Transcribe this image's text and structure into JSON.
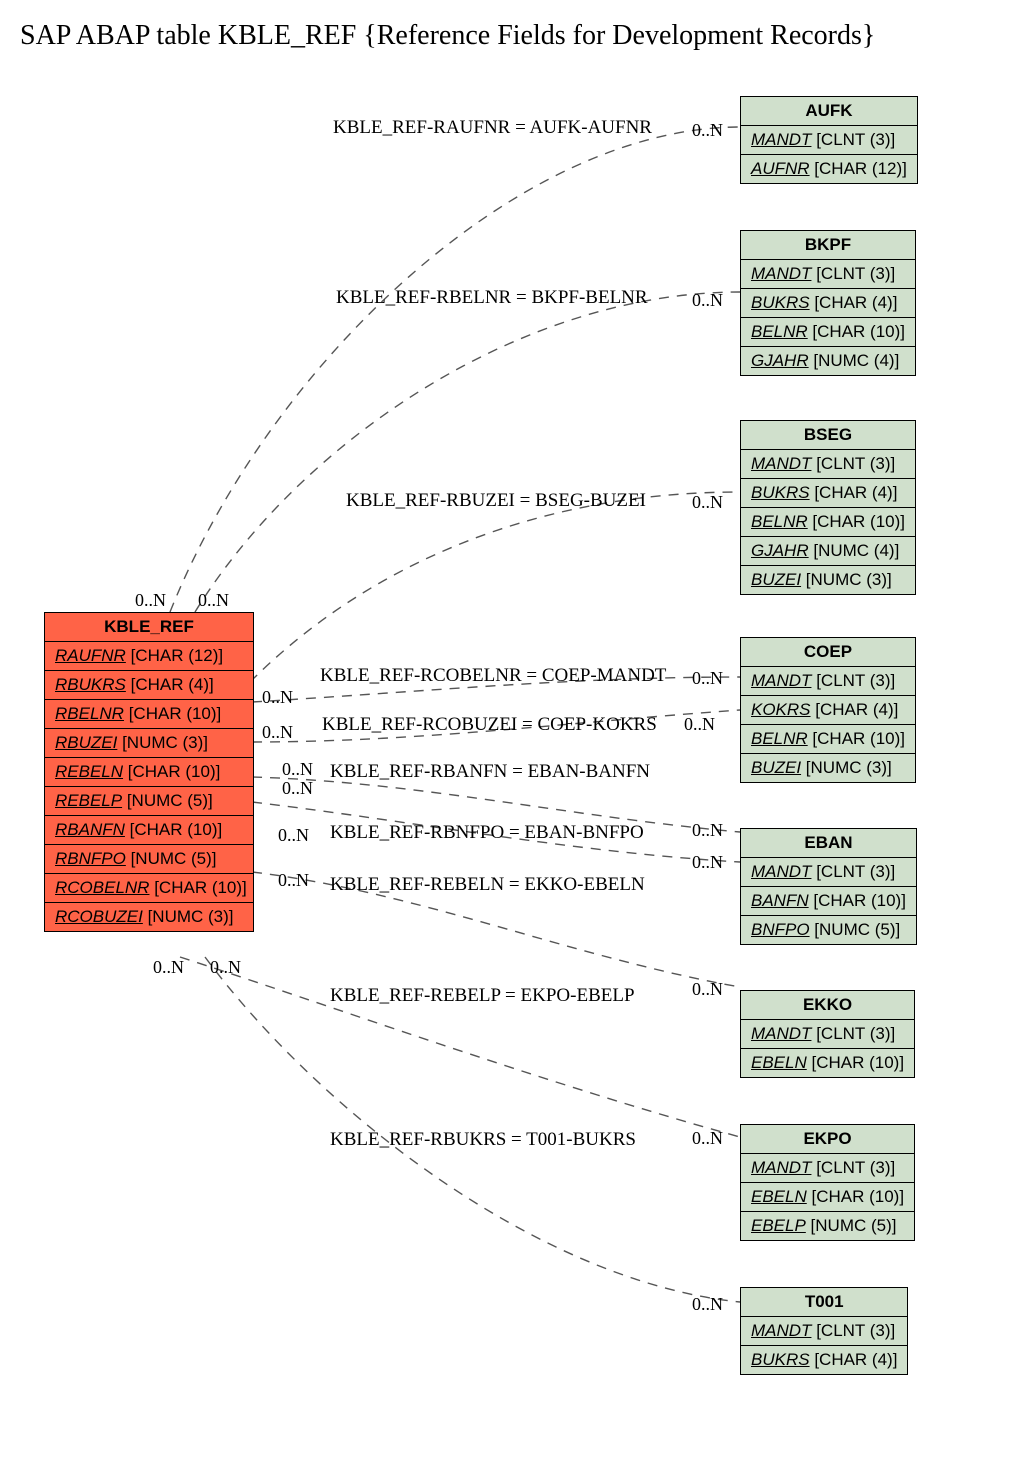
{
  "title": "SAP ABAP table KBLE_REF {Reference Fields for Development Records}",
  "source": {
    "name": "KBLE_REF",
    "fields": [
      {
        "name": "RAUFNR",
        "type": "[CHAR (12)]"
      },
      {
        "name": "RBUKRS",
        "type": "[CHAR (4)]"
      },
      {
        "name": "RBELNR",
        "type": "[CHAR (10)]"
      },
      {
        "name": "RBUZEI",
        "type": "[NUMC (3)]"
      },
      {
        "name": "REBELN",
        "type": "[CHAR (10)]"
      },
      {
        "name": "REBELP",
        "type": "[NUMC (5)]"
      },
      {
        "name": "RBANFN",
        "type": "[CHAR (10)]"
      },
      {
        "name": "RBNFPO",
        "type": "[NUMC (5)]"
      },
      {
        "name": "RCOBELNR",
        "type": "[CHAR (10)]"
      },
      {
        "name": "RCOBUZEI",
        "type": "[NUMC (3)]"
      }
    ]
  },
  "targets": [
    {
      "name": "AUFK",
      "fields": [
        {
          "name": "MANDT",
          "type": "[CLNT (3)]"
        },
        {
          "name": "AUFNR",
          "type": "[CHAR (12)]"
        }
      ]
    },
    {
      "name": "BKPF",
      "fields": [
        {
          "name": "MANDT",
          "type": "[CLNT (3)]"
        },
        {
          "name": "BUKRS",
          "type": "[CHAR (4)]"
        },
        {
          "name": "BELNR",
          "type": "[CHAR (10)]"
        },
        {
          "name": "GJAHR",
          "type": "[NUMC (4)]"
        }
      ]
    },
    {
      "name": "BSEG",
      "fields": [
        {
          "name": "MANDT",
          "type": "[CLNT (3)]"
        },
        {
          "name": "BUKRS",
          "type": "[CHAR (4)]"
        },
        {
          "name": "BELNR",
          "type": "[CHAR (10)]"
        },
        {
          "name": "GJAHR",
          "type": "[NUMC (4)]"
        },
        {
          "name": "BUZEI",
          "type": "[NUMC (3)]"
        }
      ]
    },
    {
      "name": "COEP",
      "fields": [
        {
          "name": "MANDT",
          "type": "[CLNT (3)]"
        },
        {
          "name": "KOKRS",
          "type": "[CHAR (4)]"
        },
        {
          "name": "BELNR",
          "type": "[CHAR (10)]"
        },
        {
          "name": "BUZEI",
          "type": "[NUMC (3)]"
        }
      ]
    },
    {
      "name": "EBAN",
      "fields": [
        {
          "name": "MANDT",
          "type": "[CLNT (3)]"
        },
        {
          "name": "BANFN",
          "type": "[CHAR (10)]"
        },
        {
          "name": "BNFPO",
          "type": "[NUMC (5)]"
        }
      ]
    },
    {
      "name": "EKKO",
      "fields": [
        {
          "name": "MANDT",
          "type": "[CLNT (3)]"
        },
        {
          "name": "EBELN",
          "type": "[CHAR (10)]"
        }
      ]
    },
    {
      "name": "EKPO",
      "fields": [
        {
          "name": "MANDT",
          "type": "[CLNT (3)]"
        },
        {
          "name": "EBELN",
          "type": "[CHAR (10)]"
        },
        {
          "name": "EBELP",
          "type": "[NUMC (5)]"
        }
      ]
    },
    {
      "name": "T001",
      "fields": [
        {
          "name": "MANDT",
          "type": "[CLNT (3)]"
        },
        {
          "name": "BUKRS",
          "type": "[CHAR (4)]"
        }
      ]
    }
  ],
  "relations": [
    {
      "label": "KBLE_REF-RAUFNR = AUFK-AUFNR",
      "card_left": "0..N",
      "card_right": "0..N"
    },
    {
      "label": "KBLE_REF-RBELNR = BKPF-BELNR",
      "card_left": "0..N",
      "card_right": "0..N"
    },
    {
      "label": "KBLE_REF-RBUZEI = BSEG-BUZEI",
      "card_left": "0..N",
      "card_right": "0..N"
    },
    {
      "label": "KBLE_REF-RCOBELNR = COEP-MANDT",
      "card_left": "0..N",
      "card_right": "0..N"
    },
    {
      "label": "KBLE_REF-RCOBUZEI = COEP-KOKRS",
      "card_left": "0..N",
      "card_right": "0..N"
    },
    {
      "label": "KBLE_REF-RBANFN = EBAN-BANFN",
      "card_left": "0..N",
      "card_right": "0..N"
    },
    {
      "label": "KBLE_REF-RBNFPO = EBAN-BNFPO",
      "card_left": "0..N",
      "card_right": "0..N"
    },
    {
      "label": "KBLE_REF-REBELN = EKKO-EBELN",
      "card_left": "0..N",
      "card_right": "0..N"
    },
    {
      "label": "KBLE_REF-REBELP = EKPO-EBELP",
      "card_left": "0..N",
      "card_right": "0..N"
    },
    {
      "label": "KBLE_REF-RBUKRS = T001-BUKRS",
      "card_left": "0..N",
      "card_right": "0..N"
    }
  ]
}
